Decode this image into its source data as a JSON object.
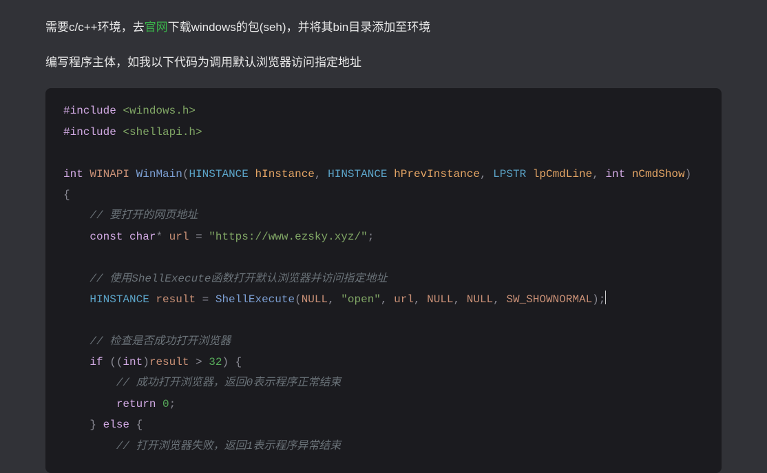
{
  "para1": {
    "pre": "需要c/c++环境，去",
    "link": "官网",
    "post": "下载windows的包(seh)，并将其bin目录添加至环境"
  },
  "para2": "编写程序主体，如我以下代码为调用默认浏览器访问指定地址",
  "code": {
    "l1a": "#include",
    "l1b": " <windows.h>",
    "l2a": "#include",
    "l2b": " <shellapi.h>",
    "int": "int",
    "winapi": "WINAPI",
    "winmain": "WinMain",
    "lp1": "(",
    "hinst_t1": "HINSTANCE",
    "hinst_p1": " hInstance",
    "comma1": ", ",
    "hinst_t2": "HINSTANCE",
    "hinst_p2": " hPrevInstance",
    "comma2": ", ",
    "lpstr_t": "LPSTR",
    "lpstr_p": " lpCmdLine",
    "comma3": ", ",
    "int_t2": "int",
    "ncmd_p": "nCmdShow",
    "rp1": ")",
    "brace1": " {",
    "cmt1": "// 要打开的网页地址",
    "const_kw": "const",
    "char_kw": " char",
    "star": "*",
    "url_var": " url ",
    "eq1": "=",
    "url_str": " \"https://www.ezsky.xyz/\"",
    "semi1": ";",
    "cmt2": "// 使用ShellExecute函数打开默认浏览器并访问指定地址",
    "hinst_t3": "HINSTANCE",
    "result_var": " result ",
    "eq2": "=",
    "shellexec": " ShellExecute",
    "lp2": "(",
    "null1": "NULL",
    "c4": ", ",
    "open_str": "\"open\"",
    "c5": ", ",
    "url_arg": "url",
    "c6": ", ",
    "null2": "NULL",
    "c7": ", ",
    "null3": "NULL",
    "c8": ", ",
    "sw_show": "SW_SHOWNORMAL",
    "rp2": ")",
    "semi2": ";",
    "cmt3": "// 检查是否成功打开浏览器",
    "if_kw": "if",
    "lp3": " ((",
    "int_cast": "int",
    "rp3": ")",
    "result_arg": "result",
    "gt": " > ",
    "n32": "32",
    "rp4": ")",
    "brace2": " {",
    "cmt4": "// 成功打开浏览器，返回0表示程序正常结束",
    "return1": "return",
    "zero": " 0",
    "semi3": ";",
    "brace3": "}",
    "else_kw": " else",
    "brace4": " {",
    "cmt5": "// 打开浏览器失败，返回1表示程序异常结束"
  }
}
